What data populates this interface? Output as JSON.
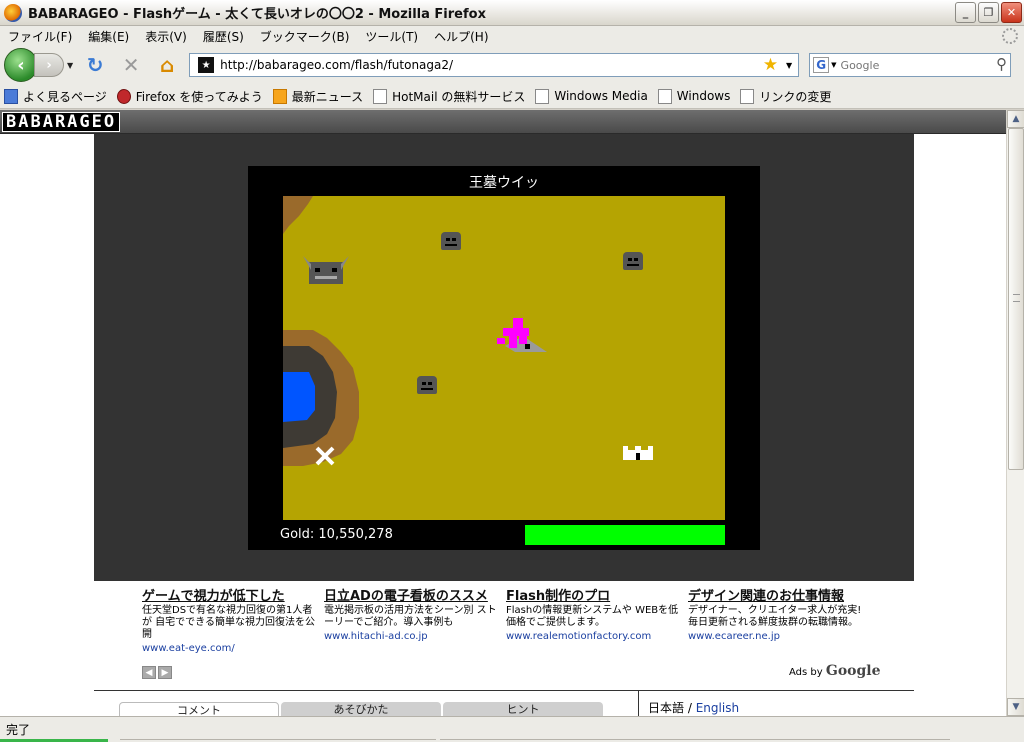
{
  "window": {
    "title": "BABARAGEO - Flashゲーム - 太くて長いオレの〇〇2 - Mozilla Firefox"
  },
  "menu": {
    "items": [
      "ファイル(F)",
      "編集(E)",
      "表示(V)",
      "履歴(S)",
      "ブックマーク(B)",
      "ツール(T)",
      "ヘルプ(H)"
    ]
  },
  "nav": {
    "url": "http://babarageo.com/flash/futonaga2/",
    "search_placeholder": "Google"
  },
  "bookmarks": {
    "items": [
      "よく見るページ",
      "Firefox を使ってみよう",
      "最新ニュース",
      "HotMail の無料サービス",
      "Windows Media",
      "Windows",
      "リンクの変更"
    ]
  },
  "site": {
    "logo": "BABARAGEO"
  },
  "game": {
    "title": "王墓ウイッ",
    "gold_text": "Gold: 10,550,278",
    "health_fraction": 1.0,
    "colors": {
      "field": "#b5a402",
      "health": "#00ff00",
      "player": "#ff00ff",
      "water": "#0055ff"
    }
  },
  "ads": [
    {
      "title": "ゲームで視力が低下した",
      "body": "任天堂DSで有名な視力回復の第1人者が 自宅でできる簡単な視力回復法を公開",
      "url": "www.eat-eye.com/"
    },
    {
      "title": "日立ADの電子看板のススメ",
      "body": "電光掲示板の活用方法をシーン別 ストーリーでご紹介。導入事例も",
      "url": "www.hitachi-ad.co.jp"
    },
    {
      "title": "Flash制作のプロ",
      "body": "Flashの情報更新システムや WEBを低価格でご提供します。",
      "url": "www.realemotionfactory.com"
    },
    {
      "title": "デザイン関連のお仕事情報",
      "body": "デザイナー、クリエイター求人が充実!毎日更新される鮮度抜群の転職情報。",
      "url": "www.ecareer.ne.jp"
    }
  ],
  "ads_by": "Ads by",
  "ads_brand": "Google",
  "lang": {
    "ja": "日本語",
    "sep": "/",
    "en": "English"
  },
  "tabs": [
    "コメント",
    "あそびかた",
    "ヒント"
  ],
  "status": {
    "text": "完了"
  }
}
